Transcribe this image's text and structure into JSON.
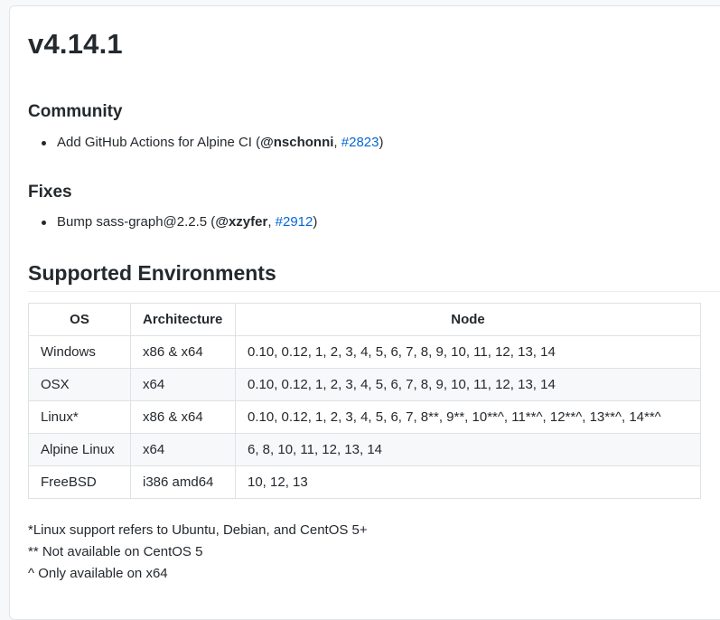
{
  "release": {
    "title": "v4.14.1"
  },
  "sections": [
    {
      "heading": "Community",
      "items": [
        {
          "text": "Add GitHub Actions for Alpine CI (",
          "mention": "@nschonni",
          "sep": ", ",
          "pr": "#2823",
          "close": ")"
        }
      ]
    },
    {
      "heading": "Fixes",
      "items": [
        {
          "text": "Bump sass-graph@2.2.5 (",
          "mention": "@xzyfer",
          "sep": ", ",
          "pr": "#2912",
          "close": ")"
        }
      ]
    }
  ],
  "environments": {
    "title": "Supported Environments",
    "headers": [
      "OS",
      "Architecture",
      "Node"
    ],
    "rows": [
      [
        "Windows",
        "x86 & x64",
        "0.10, 0.12, 1, 2, 3, 4, 5, 6, 7, 8, 9, 10, 11, 12, 13, 14"
      ],
      [
        "OSX",
        "x64",
        "0.10, 0.12, 1, 2, 3, 4, 5, 6, 7, 8, 9, 10, 11, 12, 13, 14"
      ],
      [
        "Linux*",
        "x86 & x64",
        "0.10, 0.12, 1, 2, 3, 4, 5, 6, 7, 8**, 9**, 10**^, 11**^, 12**^, 13**^, 14**^"
      ],
      [
        "Alpine Linux",
        "x64",
        "6, 8, 10, 11, 12, 13, 14"
      ],
      [
        "FreeBSD",
        "i386 amd64",
        "10, 12, 13"
      ]
    ]
  },
  "notes": [
    "*Linux support refers to Ubuntu, Debian, and CentOS 5+",
    "** Not available on CentOS 5",
    "^ Only available on x64"
  ],
  "colors": {
    "link": "#0366d6",
    "text": "#24292e",
    "border": "#dfe2e5",
    "stripe": "#f6f8fa"
  }
}
